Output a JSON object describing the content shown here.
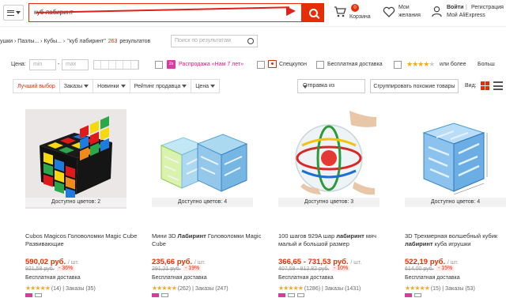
{
  "header": {
    "search_value": "куб лабиринт",
    "cart_count": "0",
    "cart_label": "Корзина",
    "wish_line1": "Мои",
    "wish_line2": "желания",
    "login": "Войти",
    "sep": "|",
    "register": "Регистрация",
    "my_account": "Мой AliExpress",
    "accent": "#e62e04"
  },
  "breadcrumb": {
    "items": [
      "ушки › Пазлы... › Кубы... ›",
      "\"куб лабиринт\""
    ],
    "count": "263",
    "results_word": "результатов",
    "search_in_results_placeholder": "Поиск по результатам"
  },
  "filters": {
    "price_label": "Цена:",
    "min_placeholder": "min",
    "dash": "-",
    "max_placeholder": "max",
    "sale_badge": "2x",
    "sale_label": "Распродажа «Нам 7 лет»",
    "coupon_label": "Спецкупон",
    "free_shipping_label": "Бесплатная доставка",
    "stars": "★★★★",
    "star_gray": "★",
    "or_more": "или более",
    "bigger": "Больш"
  },
  "sort": {
    "items": [
      "Лучший выбор",
      "Заказы",
      "Новинки",
      "Рейтинг продавца",
      "Цена"
    ],
    "ship_from": "Отправка из",
    "group_button": "Сгруппировать похожие товары",
    "view_label": "Вид:"
  },
  "products": [
    {
      "avail": "Доступно цветов: 2",
      "title_pre": "Cubos Magicos Головоломки Magic Cube Развивающие",
      "title_bold": "",
      "title_post": "",
      "price": "590,02 руб.",
      "unit": "/ шт.",
      "old_price": "921,58 руб.",
      "discount": "- 36%",
      "shipping": "Бесплатная доставка",
      "stars": "★★★★★",
      "reviews": "(14)",
      "orders": "Заказы (35)"
    },
    {
      "avail": "Доступно цветов: 4",
      "title_pre": "Мини 3D ",
      "title_bold": "Лабиринт",
      "title_post": " Головоломки Magic Cube",
      "price": "235,66 руб.",
      "unit": "/ шт.",
      "old_price": "291,21 руб.",
      "discount": "- 19%",
      "shipping": "Бесплатная доставка",
      "stars": "★★★★★",
      "reviews": "(262)",
      "orders": "Заказы (247)"
    },
    {
      "avail": "Доступно цветов: 3",
      "title_pre": "100 шагов 929A шар ",
      "title_bold": "лабиринт",
      "title_post": " мяч малый и большой размер",
      "price": "366,65 - 731,53 руб.",
      "unit": "/ шт.",
      "old_price": "407,58 - 812,82 руб.",
      "discount": "- 10%",
      "shipping": "Бесплатная доставка",
      "stars": "★★★★★",
      "reviews": "(1286)",
      "orders": "Заказы (1431)"
    },
    {
      "avail": "Доступно цветов: 4",
      "title_pre": "3D Трехмерная волшебный кубик ",
      "title_bold": "лабиринт",
      "title_post": " куба игрушки",
      "price": "522,19 руб.",
      "unit": "/ шт.",
      "old_price": "614,00 руб.",
      "discount": "- 15%",
      "shipping": "Бесплатная доставка",
      "stars": "★★★★★",
      "reviews": "(15)",
      "orders": "Заказы (53)"
    }
  ]
}
